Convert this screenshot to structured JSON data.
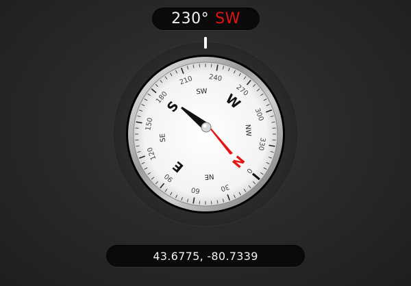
{
  "heading": {
    "degrees": "230°",
    "direction": "SW",
    "direction_color": "#e51414"
  },
  "coordinates": {
    "text": "43.6775, -80.7339"
  },
  "compass": {
    "dial_rotation_deg": 130,
    "degree_labels": [
      {
        "angle": 30,
        "text": "30"
      },
      {
        "angle": 60,
        "text": "60"
      },
      {
        "angle": 90,
        "text": "90"
      },
      {
        "angle": 120,
        "text": "120"
      },
      {
        "angle": 150,
        "text": "150"
      },
      {
        "angle": 180,
        "text": "180"
      },
      {
        "angle": 210,
        "text": "210"
      },
      {
        "angle": 240,
        "text": "240"
      },
      {
        "angle": 270,
        "text": "270"
      },
      {
        "angle": 300,
        "text": "300"
      },
      {
        "angle": 330,
        "text": "330"
      },
      {
        "angle": 0,
        "text": "0"
      }
    ],
    "cardinal_labels": [
      {
        "angle": 0,
        "text": "N",
        "color": "#e51414"
      },
      {
        "angle": 90,
        "text": "E",
        "color": "#111111"
      },
      {
        "angle": 180,
        "text": "S",
        "color": "#111111"
      },
      {
        "angle": 270,
        "text": "W",
        "color": "#111111"
      }
    ],
    "intercardinal_labels": [
      {
        "angle": 45,
        "text": "NE"
      },
      {
        "angle": 135,
        "text": "SE"
      },
      {
        "angle": 225,
        "text": "SW"
      },
      {
        "angle": 315,
        "text": "NW"
      }
    ],
    "needle_north_color": "#e51414",
    "needle_south_color": "#111111"
  }
}
